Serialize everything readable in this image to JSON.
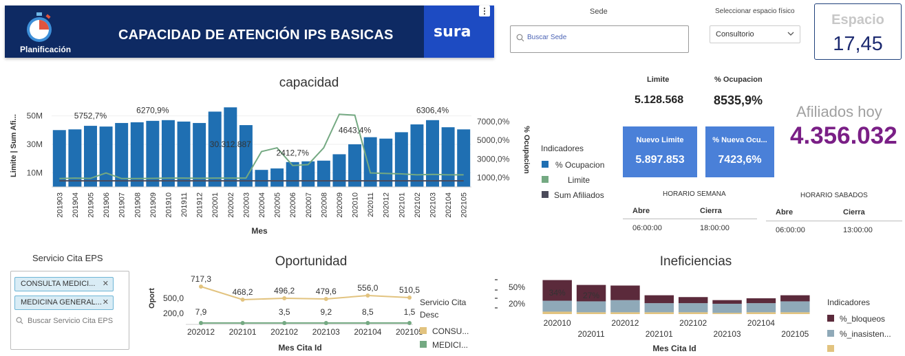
{
  "header": {
    "title": "CAPACIDAD DE ATENCIÓN IPS BASICAS",
    "plan_label": "Planificación",
    "logo_text": "sura",
    "menu": "⋮"
  },
  "filters": {
    "sede_label": "Sede",
    "sede_placeholder": "Buscar Sede",
    "espacio_label": "Seleccionar espacio físico",
    "espacio_value": "Consultorio"
  },
  "espacio_card": {
    "title": "Espacio",
    "value": "17,45"
  },
  "kpis": {
    "limite_label": "Limite",
    "limite_value": "5.128.568",
    "ocup_label": "% Ocupacion",
    "ocup_value": "8535,9%",
    "nuevo_limite_label": "Nuevo Limite",
    "nuevo_limite_value": "5.897.853",
    "nueva_ocup_label": "% Nueva Ocu...",
    "nueva_ocup_value": "7423,6%",
    "afiliados_label": "Afiliados hoy",
    "afiliados_value": "4.356.032"
  },
  "horario_semana": {
    "title": "HORARIO SEMANA",
    "col1": "Abre",
    "col2": "Cierra",
    "abre": "06:00:00",
    "cierra": "18:00:00"
  },
  "horario_sabados": {
    "title": "HORARIO SABADOS",
    "col1": "Abre",
    "col2": "Cierra",
    "abre": "06:00:00",
    "cierra": "13:00:00"
  },
  "servicio": {
    "title": "Servicio Cita EPS",
    "chips": [
      "CONSULTA MEDICI...",
      "MEDICINA GENERAL..."
    ],
    "placeholder": "Buscar Servicio Cita EPS"
  },
  "colors": {
    "bar": "#1f6fb2",
    "line_green": "#74a982",
    "line_dark": "#4a4a5a",
    "gold": "#e2c37f",
    "purple": "#7a1f86",
    "bloqueos": "#5b2a3b",
    "inasist": "#8fa9b8"
  },
  "chart_data": [
    {
      "type": "bar",
      "title": "capacidad",
      "xlabel": "Mes",
      "ylabel": "Limite | Sum Afi...",
      "y2label": "% Ocupacion",
      "categories": [
        "201903",
        "201904",
        "201905",
        "201906",
        "201907",
        "201908",
        "201909",
        "201910",
        "201911",
        "201912",
        "202001",
        "202002",
        "202003",
        "202004",
        "202005",
        "202006",
        "202007",
        "202008",
        "202009",
        "202010",
        "202011",
        "202012",
        "202101",
        "202102",
        "202103",
        "202104",
        "202105"
      ],
      "ylim": [
        0,
        59
      ],
      "y_ticks": [
        "10M",
        "30M",
        "50M"
      ],
      "y2lim": [
        0,
        9000
      ],
      "y2_ticks": [
        "1000,0%",
        "3000,0%",
        "5000,0%",
        "7000,0%"
      ],
      "series": [
        {
          "name": "Limite",
          "kind": "bar",
          "values": [
            40,
            40.5,
            43,
            42.5,
            45,
            45.5,
            46.5,
            47,
            46,
            45,
            53,
            56,
            43.5,
            12,
            13,
            17.5,
            18,
            18.5,
            23,
            30,
            35,
            34,
            38.5,
            44,
            47,
            42,
            40.5
          ]
        },
        {
          "name": "% Ocupacion",
          "kind": "line",
          "values": [
            900,
            950,
            920,
            1500,
            900,
            900,
            920,
            950,
            950,
            930,
            950,
            950,
            950,
            3800,
            4200,
            2300,
            2400,
            4200,
            7800,
            7700,
            1500,
            1450,
            1400,
            1300,
            1350,
            1300,
            1300
          ]
        },
        {
          "name": "Sum Afiliados",
          "kind": "line",
          "values": [
            4.3,
            4.3,
            4.3,
            4.3,
            4.3,
            4.3,
            4.3,
            4.3,
            4.3,
            4.3,
            4.3,
            4.3,
            4.3,
            4.3,
            4.3,
            4.3,
            4.3,
            4.3,
            4.3,
            4.3,
            4.3,
            4.3,
            4.3,
            4.3,
            4.3,
            4.3,
            4.3
          ]
        }
      ],
      "annotations": [
        {
          "cat": "201905",
          "text": "5752,7%",
          "y": 48
        },
        {
          "cat": "201909",
          "text": "6270,9%",
          "y": 52
        },
        {
          "cat": "202002",
          "text": "30.312.887",
          "y": 28
        },
        {
          "cat": "202006",
          "text": "2412,7%",
          "y": 22
        },
        {
          "cat": "202010",
          "text": "4643,4%",
          "y": 38
        },
        {
          "cat": "202103",
          "text": "6306,4%",
          "y": 52
        }
      ],
      "legend": {
        "title": "Indicadores",
        "items": [
          "% Ocupacion",
          "Limite",
          "Sum Afiliados"
        ],
        "placement": "right"
      }
    },
    {
      "type": "line",
      "title": "Oportunidad",
      "xlabel": "Mes Cita Id",
      "ylabel": "Oport",
      "categories": [
        "202012",
        "202101",
        "202102",
        "202103",
        "202104",
        "202105"
      ],
      "y_ticks": [
        "200,0",
        "500,0"
      ],
      "ylim": [
        0,
        800
      ],
      "series": [
        {
          "name": "CONSU...",
          "values": [
            717.3,
            468.2,
            496.2,
            479.6,
            556.0,
            510.5
          ],
          "labels": [
            "717,3",
            "468,2",
            "496,2",
            "479,6",
            "556,0",
            "510,5"
          ]
        },
        {
          "name": "MEDICI...",
          "values": [
            7.9,
            0,
            3.5,
            9.2,
            8.5,
            1.5
          ],
          "labels": [
            "7,9",
            "",
            "3,5",
            "9,2",
            "8,5",
            "1,5"
          ]
        }
      ],
      "legend": {
        "title": "Servicio Cita Desc",
        "placement": "right"
      }
    },
    {
      "type": "bar",
      "title": "Ineficiencias",
      "categories": [
        "202010",
        "202011",
        "202012",
        "202101",
        "202102",
        "202103",
        "202104",
        "202105"
      ],
      "y_ticks": [
        "20%",
        "50%"
      ],
      "ylim": [
        0,
        60
      ],
      "series": [
        {
          "name": "%_bloqueos",
          "values": [
            34,
            27,
            24,
            13,
            10,
            6,
            8,
            10
          ]
        },
        {
          "name": "%_inasisten...",
          "values": [
            18,
            18,
            20,
            15,
            15,
            15,
            15,
            18
          ]
        },
        {
          "name": "%_...",
          "values": [
            4,
            3,
            3,
            3,
            3,
            2,
            3,
            3
          ]
        }
      ],
      "annotations": [
        "34%",
        "27%"
      ],
      "legend": {
        "title": "Indicadores",
        "items": [
          "%_bloqueos",
          "%_inasisten..."
        ],
        "placement": "right"
      }
    }
  ]
}
